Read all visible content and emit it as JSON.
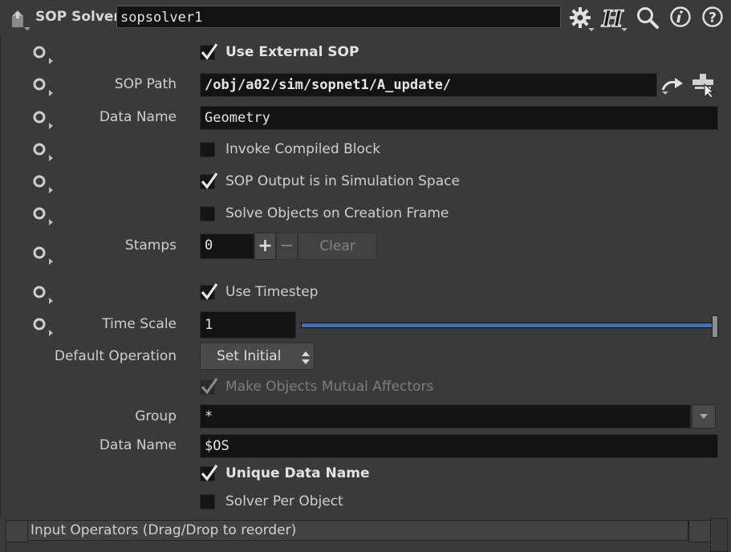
{
  "header": {
    "node_type": "SOP Solver",
    "node_name": "sopsolver1",
    "icons": [
      "gear-icon",
      "help-h-icon",
      "search-icon",
      "info-icon",
      "question-icon"
    ]
  },
  "params": {
    "use_external_sop": {
      "label": "Use External SOP",
      "checked": true
    },
    "sop_path": {
      "label": "SOP Path",
      "value": "/obj/a02/sim/sopnet1/A_update/"
    },
    "data_name": {
      "label": "Data Name",
      "value": "Geometry"
    },
    "invoke_compiled_block": {
      "label": "Invoke Compiled Block",
      "checked": false
    },
    "sop_output_sim_space": {
      "label": "SOP Output is in Simulation Space",
      "checked": true
    },
    "solve_on_creation": {
      "label": "Solve Objects on Creation Frame",
      "checked": false
    },
    "stamps": {
      "label": "Stamps",
      "value": "0",
      "plus": "+",
      "minus": "−",
      "clear": "Clear"
    },
    "use_timestep": {
      "label": "Use Timestep",
      "checked": true
    },
    "time_scale": {
      "label": "Time Scale",
      "value": "1",
      "slider_fraction": 1.0
    },
    "default_operation": {
      "label": "Default Operation",
      "value": "Set Initial"
    },
    "mutual_affectors": {
      "label": "Make Objects Mutual Affectors",
      "checked": true
    },
    "group": {
      "label": "Group",
      "value": "*"
    },
    "data_name2": {
      "label": "Data Name",
      "value": "$OS"
    },
    "unique_data_name": {
      "label": "Unique Data Name",
      "checked": true
    },
    "solver_per_object": {
      "label": "Solver Per Object",
      "checked": false
    }
  },
  "footer": {
    "input_operators": "Input Operators (Drag/Drop to reorder)"
  },
  "colors": {
    "background": "#3a3a3a",
    "field": "#131313",
    "slider": "#3f6fb8"
  }
}
